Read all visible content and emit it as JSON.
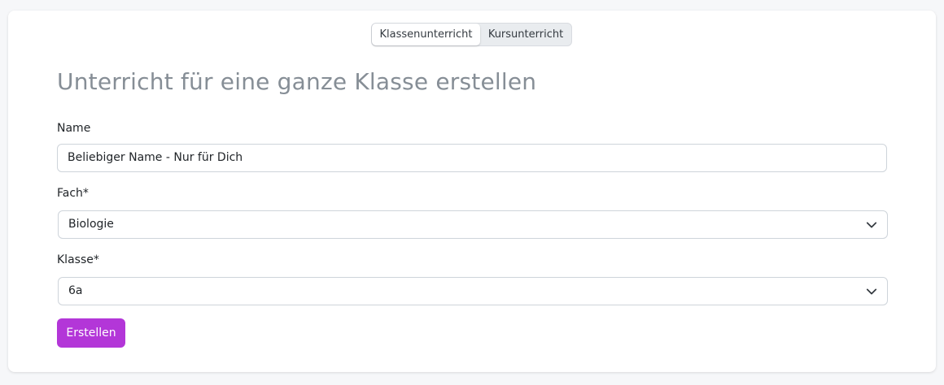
{
  "toggle": {
    "options": [
      {
        "label": "Klassenunterricht",
        "active": true
      },
      {
        "label": "Kursunterricht",
        "active": false
      }
    ]
  },
  "page": {
    "title": "Unterricht für eine ganze Klasse erstellen"
  },
  "form": {
    "name": {
      "label": "Name",
      "value": "Beliebiger Name - Nur für Dich"
    },
    "fach": {
      "label": "Fach*",
      "value": "Biologie"
    },
    "klasse": {
      "label": "Klasse*",
      "value": "6a"
    },
    "submit_label": "Erstellen"
  },
  "colors": {
    "accent": "#b336d8",
    "title": "#868e96",
    "background": "#f6f7f9"
  },
  "icons": {
    "select_chevron": "chevron-down-icon"
  }
}
